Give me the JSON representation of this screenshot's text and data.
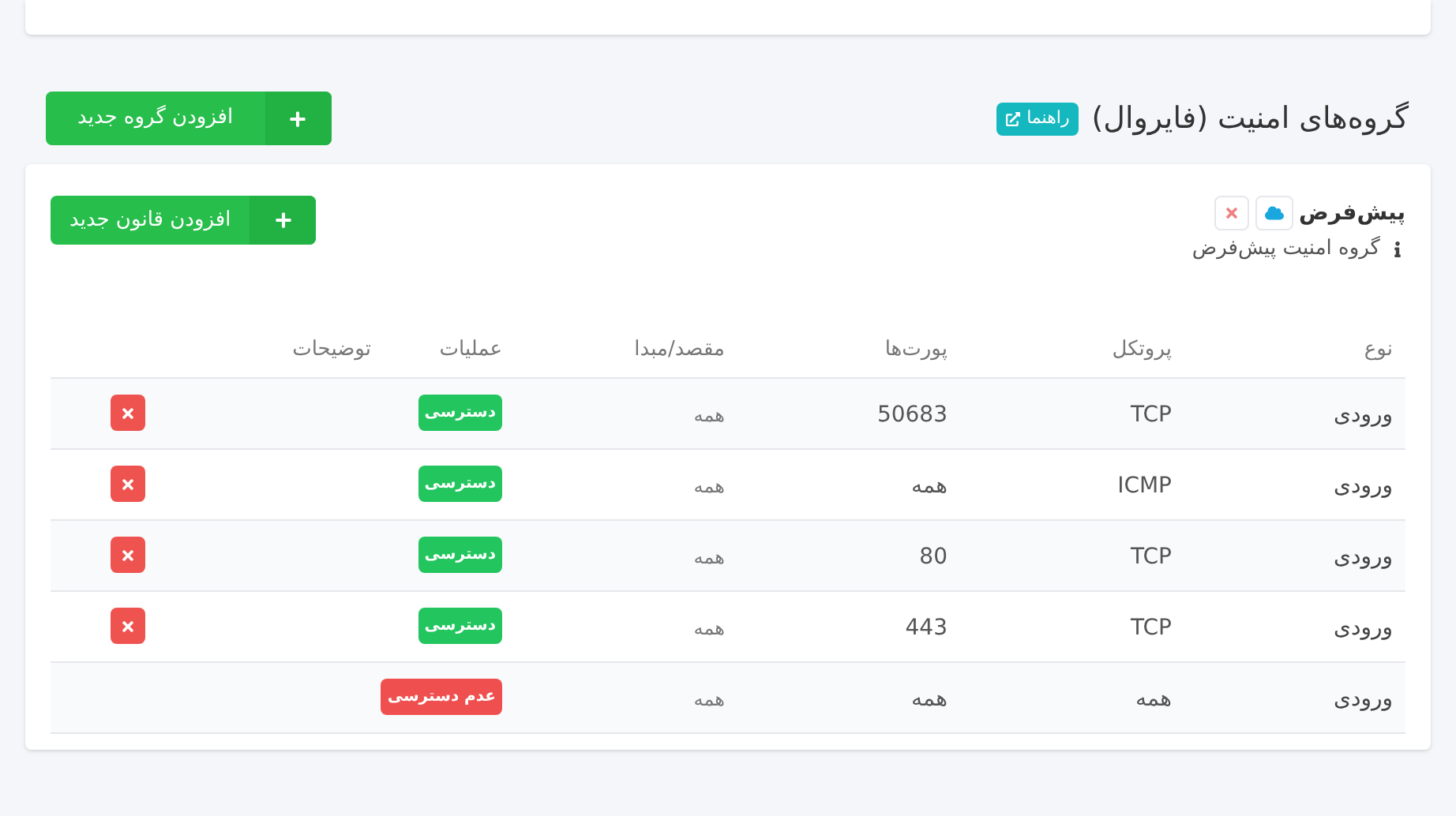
{
  "page_title": "گروه‌های امنیت (فایروال)",
  "help_badge": "راهنما",
  "add_group_button": "افزودن گروه جدید",
  "group": {
    "name": "پیش‌فرض",
    "description": "گروه امنیت پیش‌فرض",
    "add_rule_button": "افزودن قانون جدید",
    "table": {
      "columns": [
        "نوع",
        "پروتکل",
        "پورت‌ها",
        "مقصد/مبدا",
        "عملیات",
        "توضیحات"
      ],
      "rows": [
        {
          "type": "ورودی",
          "protocol": "TCP",
          "ports": "50683",
          "target": "همه",
          "action": {
            "kind": "allow",
            "label": "دسترسی"
          },
          "deletable": true
        },
        {
          "type": "ورودی",
          "protocol": "ICMP",
          "ports": "همه",
          "target": "همه",
          "action": {
            "kind": "allow",
            "label": "دسترسی"
          },
          "deletable": true
        },
        {
          "type": "ورودی",
          "protocol": "TCP",
          "ports": "80",
          "target": "همه",
          "action": {
            "kind": "allow",
            "label": "دسترسی"
          },
          "deletable": true
        },
        {
          "type": "ورودی",
          "protocol": "TCP",
          "ports": "443",
          "target": "همه",
          "action": {
            "kind": "allow",
            "label": "دسترسی"
          },
          "deletable": true
        },
        {
          "type": "ورودی",
          "protocol": "همه",
          "ports": "همه",
          "target": "همه",
          "action": {
            "kind": "deny",
            "label": "عدم دسترسی"
          },
          "deletable": false
        }
      ]
    }
  }
}
